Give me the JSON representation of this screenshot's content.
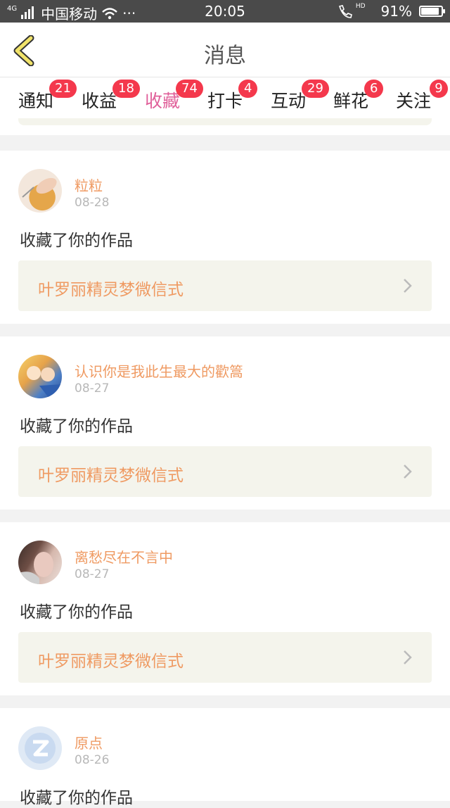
{
  "status_bar": {
    "network": "4G",
    "carrier": "中国移动",
    "extra": "···",
    "time": "20:05",
    "hd": "HD",
    "battery_text": "91%",
    "battery_level": 0.91
  },
  "header": {
    "title": "消息",
    "back_icon": "chevron-left-icon",
    "accent_color": "#f1e36a"
  },
  "tabs": [
    {
      "label": "通知",
      "badge": "21",
      "active": false
    },
    {
      "label": "收益",
      "badge": "18",
      "active": false
    },
    {
      "label": "收藏",
      "badge": "74",
      "active": true
    },
    {
      "label": "打卡",
      "badge": "4",
      "active": false
    },
    {
      "label": "互动",
      "badge": "29",
      "active": false
    },
    {
      "label": "鲜花",
      "badge": "6",
      "active": false
    },
    {
      "label": "关注",
      "badge": "9",
      "active": false
    }
  ],
  "colors": {
    "active_tab": "#e0609a",
    "badge": "#f4384c",
    "username": "#ef9a62",
    "work_bg": "#f4f4ec"
  },
  "messages": [
    {
      "user": "粒粒",
      "date": "08-28",
      "action": "收藏了你的作品",
      "work": "叶罗丽精灵梦微信式"
    },
    {
      "user": "认识你是我此生最大的歡篙",
      "date": "08-27",
      "action": "收藏了你的作品",
      "work": "叶罗丽精灵梦微信式"
    },
    {
      "user": "离愁尽在不言中",
      "date": "08-27",
      "action": "收藏了你的作品",
      "work": "叶罗丽精灵梦微信式"
    },
    {
      "user": "原点",
      "date": "08-26",
      "action": "收藏了你的作品",
      "work": ""
    }
  ]
}
